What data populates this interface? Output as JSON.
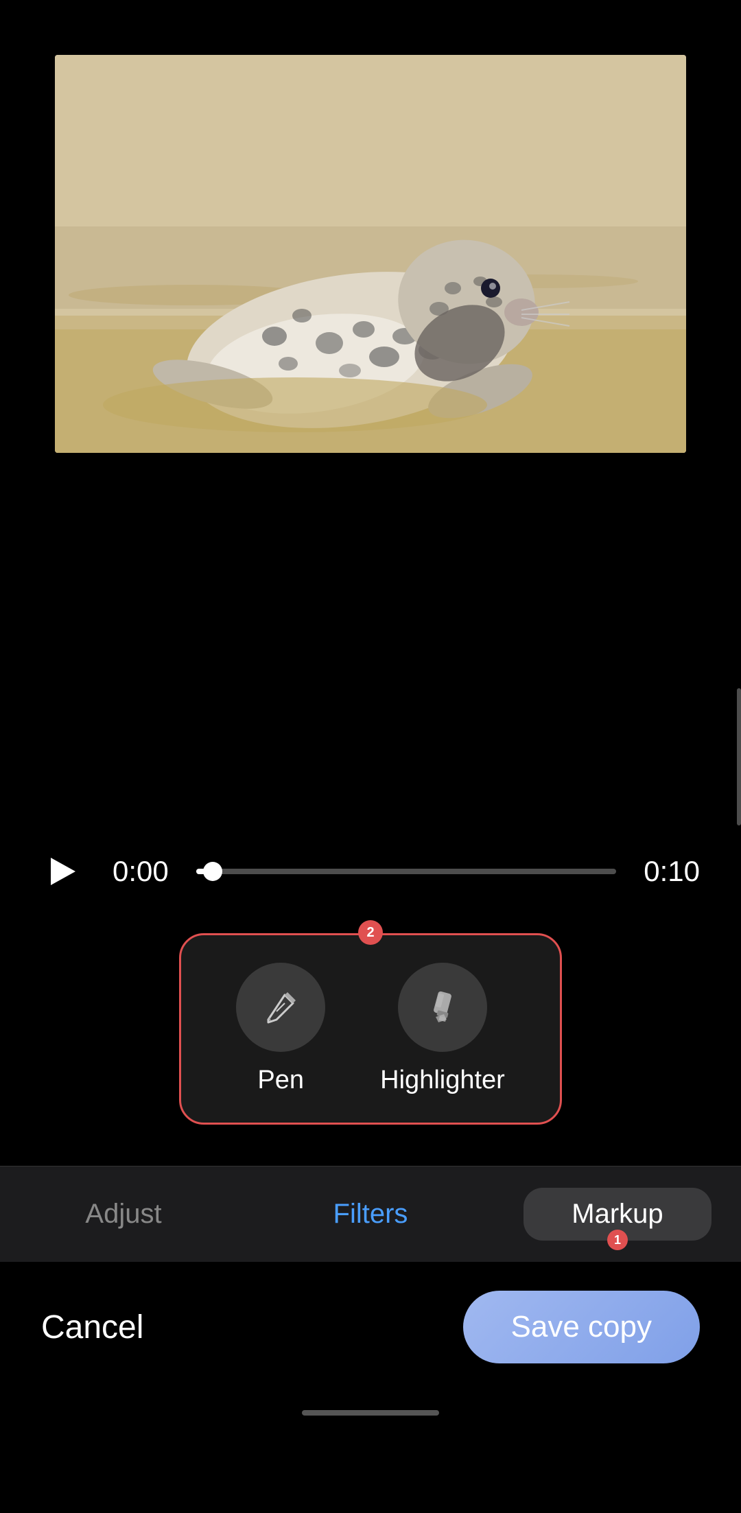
{
  "media": {
    "image_alt": "Seal on a beach"
  },
  "video_controls": {
    "time_current": "0:00",
    "time_total": "0:10",
    "progress_percent": 4
  },
  "tool_popup": {
    "badge": "2",
    "tools": [
      {
        "id": "pen",
        "label": "Pen",
        "icon": "pen-icon"
      },
      {
        "id": "highlighter",
        "label": "Highlighter",
        "icon": "highlighter-icon"
      }
    ]
  },
  "tabs": [
    {
      "id": "adjust",
      "label": "Adjust",
      "state": "inactive"
    },
    {
      "id": "filters",
      "label": "Filters",
      "state": "blue"
    },
    {
      "id": "markup",
      "label": "Markup",
      "state": "active",
      "badge": "1"
    }
  ],
  "actions": {
    "cancel_label": "Cancel",
    "save_label": "Save copy"
  }
}
